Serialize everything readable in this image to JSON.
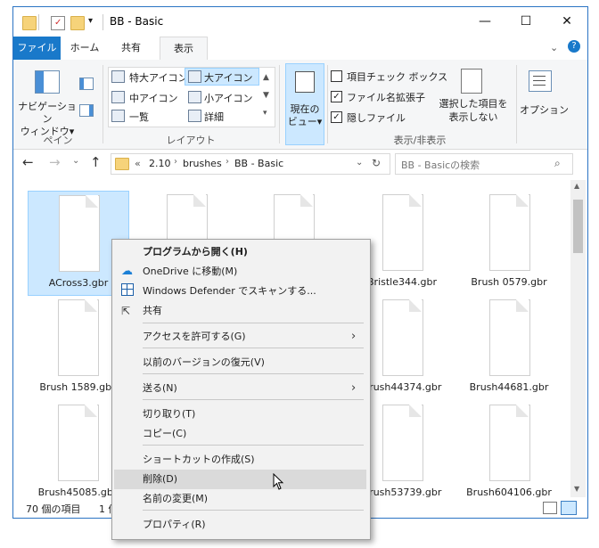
{
  "window": {
    "title": "BB - Basic",
    "controls": {
      "minimize": "—",
      "maximize": "☐",
      "close": "✕"
    }
  },
  "tabs": [
    "ファイル",
    "ホーム",
    "共有",
    "表示"
  ],
  "ribbon": {
    "pane": {
      "nav_pane_label": "ナビゲーション\nウィンドウ▾",
      "group_label": "ペイン"
    },
    "layout": {
      "items": [
        "特大アイコン",
        "大アイコン",
        "中アイコン",
        "小アイコン",
        "一覧",
        "詳細"
      ],
      "group_label": "レイアウト"
    },
    "current_view": {
      "label": "現在の\nビュー▾"
    },
    "show_hide": {
      "item_checkboxes": "項目チェック ボックス",
      "file_extensions": "ファイル名拡張子",
      "hidden_items": "隠しファイル",
      "hide_selected": "選択した項目を\n表示しない",
      "group_label": "表示/非表示"
    },
    "options": "オプション"
  },
  "address": {
    "path": [
      "«",
      "2.10",
      "brushes",
      "BB - Basic"
    ],
    "search_placeholder": "BB - Basicの検索"
  },
  "files": [
    "ACross3.gbr",
    "",
    "",
    "Bristle344.gbr",
    "Brush 0579.gbr",
    "Brush 1589.gbr",
    "",
    "",
    "Brush44374.gbr",
    "Brush44681.gbr",
    "Brush45085.gbr",
    "",
    "",
    "Brush53739.gbr",
    "Brush604106.gbr"
  ],
  "status": {
    "count": "70 個の項目",
    "selected": "1 個"
  },
  "context_menu": {
    "items": [
      {
        "label": "プログラムから開く(H)",
        "bold": true
      },
      {
        "label": "OneDrive に移動(M)",
        "icon": "onedrive-icon"
      },
      {
        "label": "Windows Defender でスキャンする...",
        "icon": "defender-icon"
      },
      {
        "label": "共有",
        "icon": "share-icon"
      },
      {
        "label": "アクセスを許可する(G)",
        "submenu": true
      },
      {
        "label": "以前のバージョンの復元(V)"
      },
      {
        "label": "送る(N)",
        "submenu": true
      },
      {
        "label": "切り取り(T)"
      },
      {
        "label": "コピー(C)"
      },
      {
        "label": "ショートカットの作成(S)"
      },
      {
        "label": "削除(D)",
        "hover": true
      },
      {
        "label": "名前の変更(M)"
      },
      {
        "label": "プロパティ(R)"
      }
    ]
  },
  "colors": {
    "accent": "#1979ca",
    "selection": "#cce8ff",
    "folder": "#f6d37a"
  }
}
